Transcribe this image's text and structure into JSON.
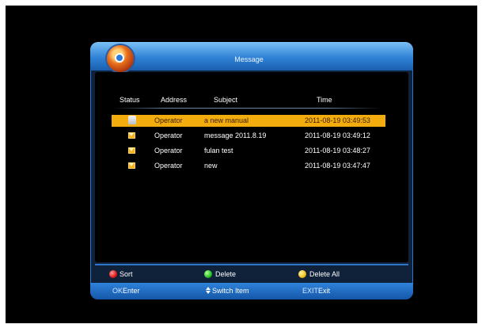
{
  "window": {
    "title": "Message"
  },
  "table": {
    "headers": {
      "status": "Status",
      "address": "Address",
      "subject": "Subject",
      "time": "Time"
    },
    "rows": [
      {
        "status_icon": "mail-open-icon",
        "address": "Operator",
        "subject": "a new manual",
        "time": "2011-08-19 03:49:53",
        "selected": true
      },
      {
        "status_icon": "mail-icon",
        "address": "Operator",
        "subject": "message 2011.8.19",
        "time": "2011-08-19 03:49:12",
        "selected": false
      },
      {
        "status_icon": "mail-icon",
        "address": "Operator",
        "subject": "fulan test",
        "time": "2011-08-19 03:48:27",
        "selected": false
      },
      {
        "status_icon": "mail-icon",
        "address": "Operator",
        "subject": "new",
        "time": "2011-08-19 03:47:47",
        "selected": false
      }
    ]
  },
  "color_keys": [
    {
      "color": "#e01818",
      "label": "Sort"
    },
    {
      "color": "#22c222",
      "label": "Delete"
    },
    {
      "color": "#f0c21a",
      "label": "Delete All"
    }
  ],
  "nav": {
    "ok_key": "OK",
    "ok_label": "Enter",
    "switch_label": "Switch Item",
    "exit_key": "EXIT",
    "exit_label": "Exit"
  },
  "colors": {
    "accent": "#2f82d6",
    "selection": "#f3ac0e",
    "background": "#000000"
  }
}
